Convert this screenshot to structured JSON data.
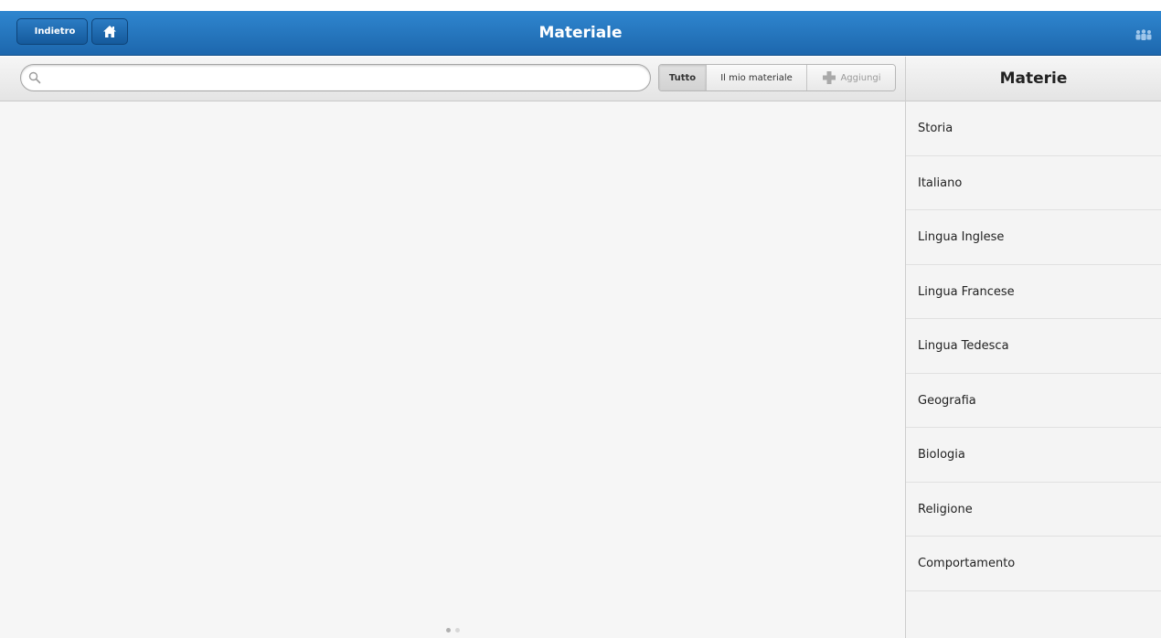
{
  "header": {
    "title": "Materiale",
    "back_label": "Indietro"
  },
  "toolbar": {
    "search_placeholder": "",
    "segments": [
      "Tutto",
      "Il mio materiale",
      "Aggiungi"
    ],
    "active_segment": "Tutto"
  },
  "sidebar": {
    "title": "Materie",
    "items": [
      {
        "label": "Storia"
      },
      {
        "label": "Italiano"
      },
      {
        "label": "Lingua Inglese"
      },
      {
        "label": "Lingua Francese"
      },
      {
        "label": "Lingua Tedesca"
      },
      {
        "label": "Geografia"
      },
      {
        "label": "Biologia"
      },
      {
        "label": "Religione"
      },
      {
        "label": "Comportamento"
      }
    ]
  },
  "pager": {
    "pages": 2,
    "current": 1
  },
  "icons": {
    "home": "home-icon",
    "users": "users-icon",
    "search": "search-icon",
    "add": "plus-icon"
  },
  "colors": {
    "header_blue": "#1f6fb8",
    "background": "#f6f6f6"
  }
}
